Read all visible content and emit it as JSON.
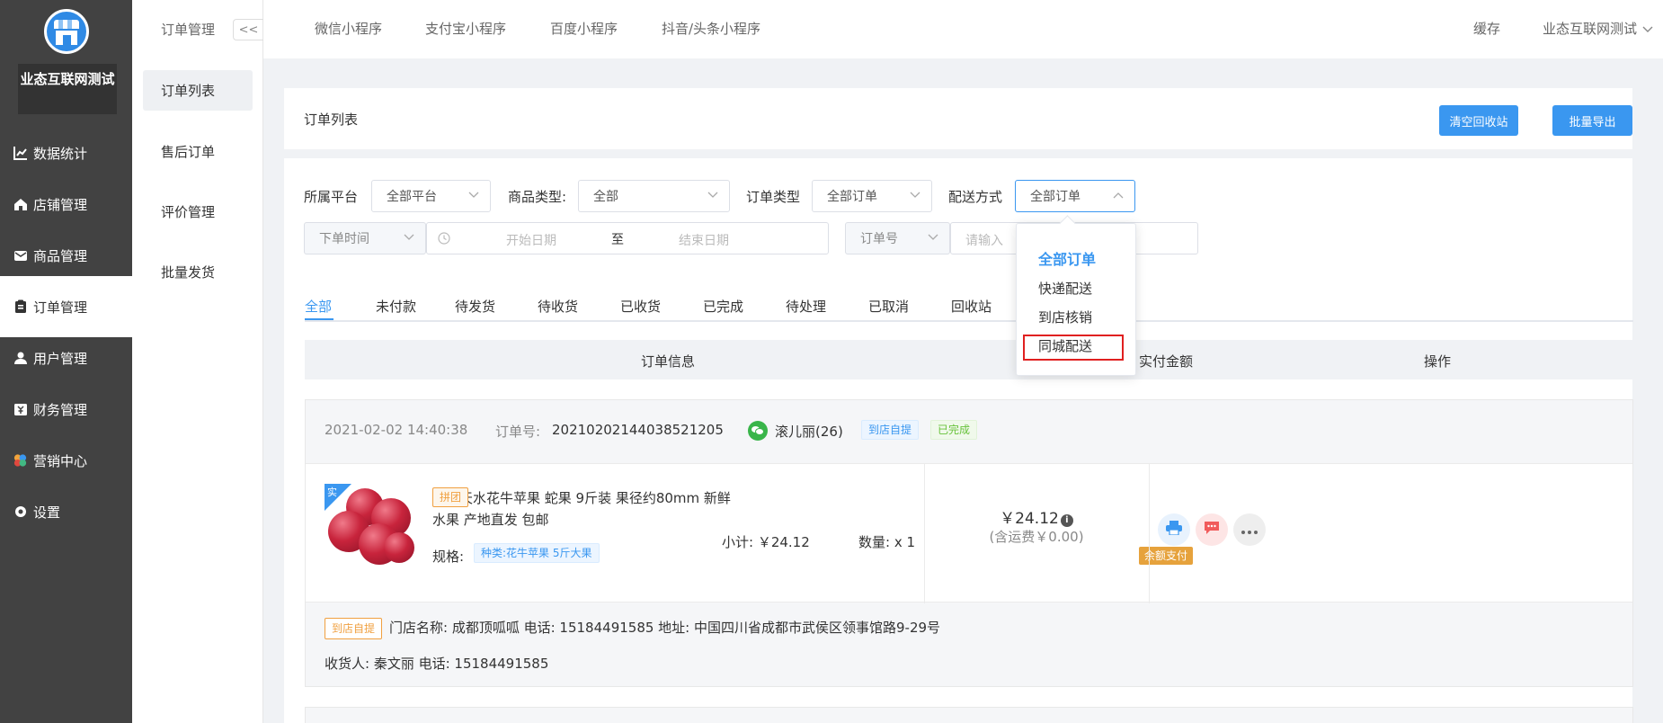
{
  "brand": {
    "name": "业态互联网测试"
  },
  "sidebar": {
    "items": [
      {
        "label": "数据统计",
        "icon": "chart-line-icon"
      },
      {
        "label": "店铺管理",
        "icon": "home-icon"
      },
      {
        "label": "商品管理",
        "icon": "mail-icon"
      },
      {
        "label": "订单管理",
        "icon": "clipboard-icon"
      },
      {
        "label": "用户管理",
        "icon": "user-icon"
      },
      {
        "label": "财务管理",
        "icon": "yen-box-icon"
      },
      {
        "label": "营销中心",
        "icon": "colorful-dots-icon"
      },
      {
        "label": "设置",
        "icon": "gear-icon"
      }
    ],
    "active": "订单管理"
  },
  "subnav": {
    "title": "订单管理",
    "collapse_label": "<<",
    "items": [
      "订单列表",
      "售后订单",
      "评价管理",
      "批量发货"
    ],
    "active": "订单列表"
  },
  "topbar": {
    "tabs": [
      "微信小程序",
      "支付宝小程序",
      "百度小程序",
      "抖音/头条小程序"
    ],
    "cache_label": "缓存",
    "user_label": "业态互联网测试"
  },
  "page": {
    "title": "订单列表",
    "clear_recycle_label": "清空回收站",
    "batch_export_label": "批量导出"
  },
  "filters": {
    "platform_label": "所属平台",
    "platform_value": "全部平台",
    "goods_type_label": "商品类型:",
    "goods_type_value": "全部",
    "order_type_label": "订单类型",
    "order_type_value": "全部订单",
    "delivery_label": "配送方式",
    "delivery_value": "全部订单",
    "time_type_value": "下单时间",
    "start_placeholder": "开始日期",
    "range_sep": "至",
    "end_placeholder": "结束日期",
    "search_type_value": "订单号",
    "search_placeholder": "请输入"
  },
  "delivery_dropdown": {
    "options": [
      "全部订单",
      "快递配送",
      "到店核销",
      "同城配送"
    ],
    "selected": "全部订单"
  },
  "status_tabs": [
    "全部",
    "未付款",
    "待发货",
    "待收货",
    "已收货",
    "已完成",
    "待处理",
    "已取消",
    "回收站"
  ],
  "table": {
    "headers": [
      "订单信息",
      "实付金额",
      "操作"
    ]
  },
  "order": {
    "time": "2021-02-02 14:40:38",
    "order_no_label": "订单号:",
    "order_no": "20210202144038521205",
    "customer": "滚儿丽(26)",
    "tag_delivery": "到店自提",
    "tag_status": "已完成",
    "product": {
      "corner_badge": "实",
      "group_tag": "拼团",
      "title": "甘肃天水花牛苹果 蛇果 9斤装 果径约80mm 新鲜水果 产地直发 包邮",
      "spec_label": "规格:",
      "spec_value": "种类:花牛苹果 5斤大果",
      "subtotal": "小计: ￥24.12",
      "quantity": "数量: x 1"
    },
    "amount": "￥24.12",
    "freight": "(含运费￥0.00)",
    "pay_method": "余额支付",
    "footer_tag": "到店自提",
    "store_info": "门店名称: 成都顶呱呱 电话: 15184491585 地址: 中国四川省成都市武侯区领事馆路9-29号",
    "receiver_info": "收货人: 秦文丽 电话: 15184491585"
  },
  "colors": {
    "accent": "#3a97f0",
    "sidebar_bg": "#424242",
    "highlight": "#e02020"
  }
}
